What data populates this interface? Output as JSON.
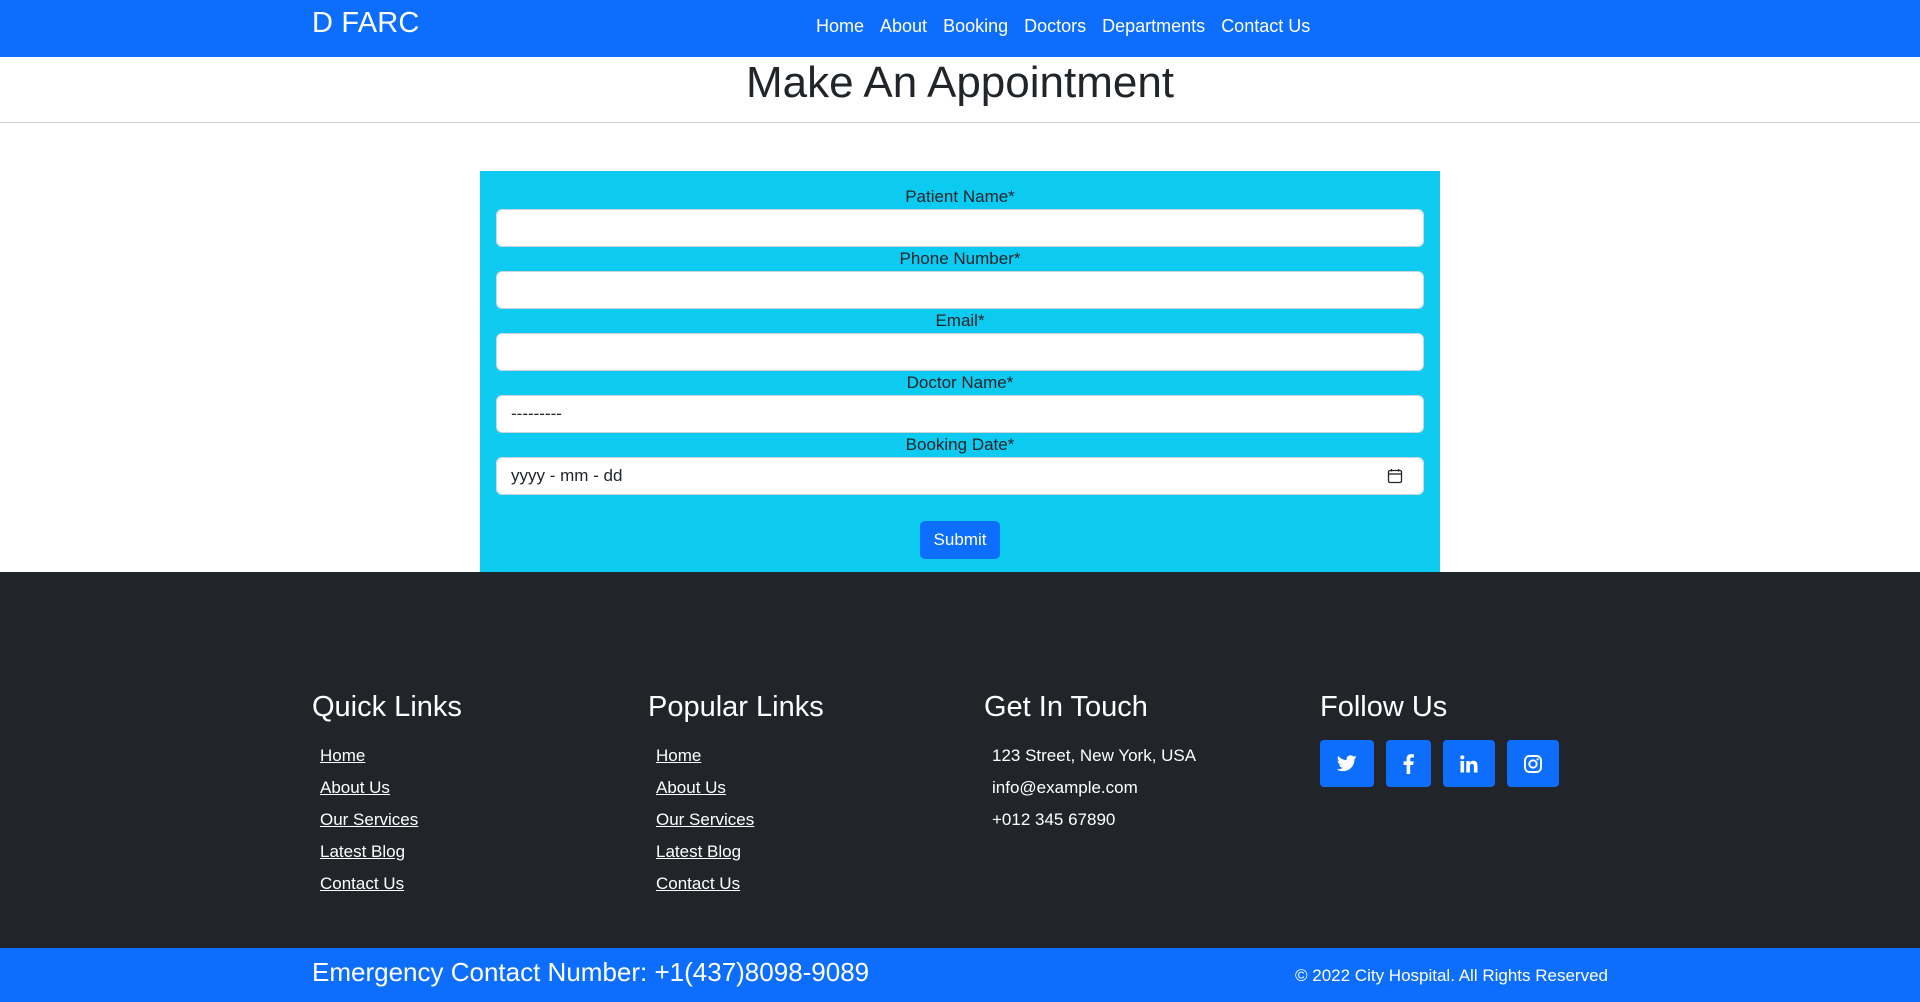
{
  "navbar": {
    "brand": "D FARC",
    "links": [
      "Home",
      "About",
      "Booking",
      "Doctors",
      "Departments",
      "Contact Us"
    ]
  },
  "page": {
    "title": "Make An Appointment"
  },
  "form": {
    "fields": [
      {
        "label": "Patient Name*",
        "value": ""
      },
      {
        "label": "Phone Number*",
        "value": ""
      },
      {
        "label": "Email*",
        "value": ""
      },
      {
        "label": "Doctor Name*",
        "value": "---------"
      },
      {
        "label": "Booking Date*",
        "value": "yyyy - mm - dd"
      }
    ],
    "submit_label": "Submit"
  },
  "footer": {
    "quick_links": {
      "heading": "Quick Links",
      "items": [
        "Home",
        "About Us",
        "Our Services",
        "Latest Blog",
        "Contact Us"
      ]
    },
    "popular_links": {
      "heading": "Popular Links",
      "items": [
        "Home",
        "About Us",
        "Our Services",
        "Latest Blog",
        "Contact Us"
      ]
    },
    "get_in_touch": {
      "heading": "Get In Touch",
      "address": "123 Street, New York, USA",
      "email": "info@example.com",
      "phone": "+012 345 67890"
    },
    "follow_us": {
      "heading": "Follow Us",
      "icons": [
        "twitter-icon",
        "facebook-icon",
        "linkedin-icon",
        "instagram-icon"
      ]
    }
  },
  "bottom_bar": {
    "emergency": "Emergency Contact Number: +1(437)8098-9089",
    "copyright": "© 2022 City Hospital. All Rights Reserved"
  },
  "colors": {
    "primary": "#0d6efd",
    "form_bg": "#0dcaf0",
    "footer_bg": "#212529"
  }
}
